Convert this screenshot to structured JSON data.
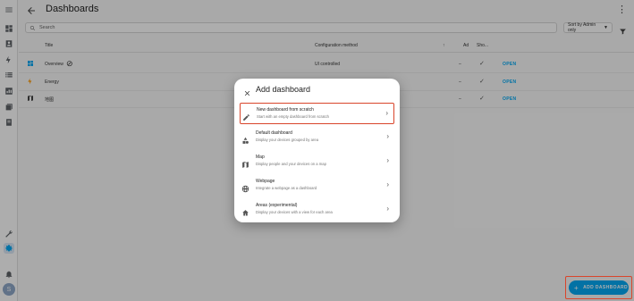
{
  "header": {
    "title": "Dashboards"
  },
  "search": {
    "placeholder": "Search"
  },
  "sort": {
    "label": "Sort by Admin only"
  },
  "table": {
    "columns": [
      "Title",
      "Configuration method",
      "Ad",
      "Sho..."
    ],
    "rows": [
      {
        "title": "Overview",
        "config": "UI controlled",
        "admin": "–",
        "action": "OPEN",
        "icon": "view-dashboard-icon"
      },
      {
        "title": "Energy",
        "config": "",
        "admin": "–",
        "action": "OPEN",
        "icon": "lightning-bolt-icon"
      },
      {
        "title": "地图",
        "config": "",
        "admin": "–",
        "action": "OPEN",
        "icon": "map-icon"
      }
    ]
  },
  "fab": {
    "label": "ADD DASHBOARD"
  },
  "user": {
    "avatar_letter": "S"
  },
  "dialog": {
    "title": "Add dashboard",
    "options": [
      {
        "title": "New dashboard from scratch",
        "desc": "Start with an empty dashboard from scratch",
        "icon": "pencil-icon"
      },
      {
        "title": "Default dashboard",
        "desc": "Display your devices grouped by area",
        "icon": "shapes-icon"
      },
      {
        "title": "Map",
        "desc": "Display people and your devices on a map",
        "icon": "map-icon"
      },
      {
        "title": "Webpage",
        "desc": "Integrate a webpage as a dashboard",
        "icon": "globe-icon"
      },
      {
        "title": "Areas (experimental)",
        "desc": "Display your devices with a view for each area",
        "icon": "home-icon"
      }
    ]
  },
  "colors": {
    "accent": "#03a9f4",
    "highlight": "#d9452b",
    "energy": "#ff9800"
  }
}
